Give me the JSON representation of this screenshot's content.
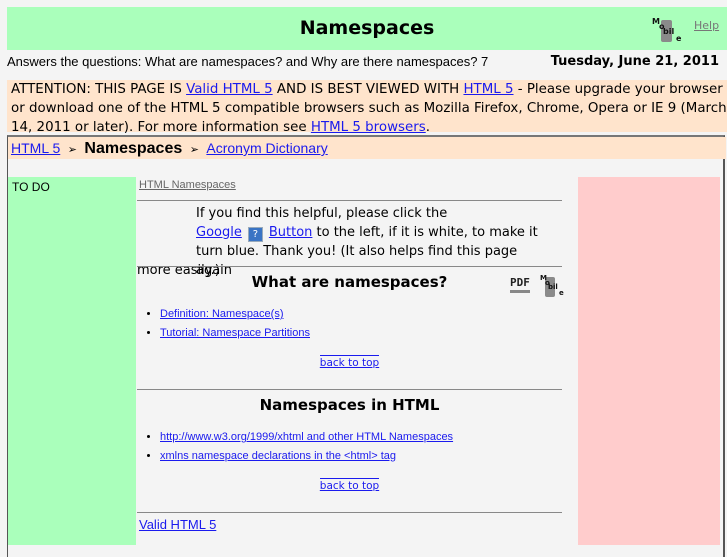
{
  "header": {
    "title": "Namespaces",
    "help_label": "Help",
    "mobile_icon": "mobile-phone-icon",
    "bg_color": "#aaffbb"
  },
  "subheader": {
    "description": "Answers the questions: What are namespaces? and Why are there namespaces? 7",
    "date": "Tuesday, June 21, 2011"
  },
  "attention": {
    "prefix": "ATTENTION: THIS PAGE IS ",
    "link1": "Valid HTML 5",
    "middle": " AND IS BEST VIEWED WITH ",
    "link2": "HTML 5",
    "rest": " - Please upgrade your browser or download one of the HTML 5 compatible browsers such as Mozilla Firefox, Chrome, Opera or IE 9 (March 14, 2011 or later). For more information see ",
    "link3": "HTML 5 browsers",
    "suffix": ".",
    "bg_color": "#ffe4cc"
  },
  "breadcrumb": {
    "items": [
      "HTML 5",
      "Namespaces",
      "Acronym Dictionary"
    ],
    "separator": "➢"
  },
  "sidebar_left": {
    "label": "TO DO"
  },
  "main": {
    "top_link": "HTML Namespaces",
    "helpful": {
      "line_start": "If you find this helpful, please click the ",
      "google_link_a": "Google",
      "google_icon": "?",
      "google_link_b": "Button",
      "line_rest": " to the left, if it is white, to make it turn blue. Thank you! (It also helps find this page again",
      "more": "more easily.)"
    },
    "sections": [
      {
        "title": "What are namespaces?",
        "links": [
          "Definition: Namespace(s)",
          "Tutorial: Namespace Partitions"
        ],
        "back_to_top": "back to top"
      },
      {
        "title": "Namespaces in HTML",
        "links": [
          "http://www.w3.org/1999/xhtml and other HTML Namespaces",
          "xmlns namespace declarations in the <html> tag"
        ],
        "back_to_top": "back to top"
      }
    ],
    "pdf_label": "PDF",
    "valid_link": "Valid HTML 5"
  },
  "colors": {
    "link": "#1a1aee",
    "left_col": "#aaffbb",
    "right_col": "#ffcccc"
  }
}
